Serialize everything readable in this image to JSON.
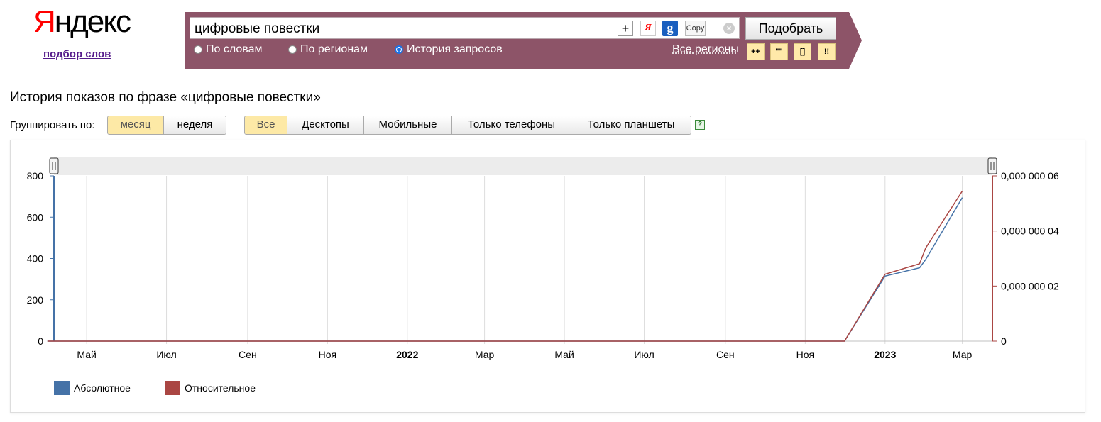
{
  "logo": {
    "first_letter": "Я",
    "rest": "ндекс"
  },
  "wordstat_link": "подбор слов",
  "search": {
    "query": "цифровые повестки",
    "plus_label": "+",
    "ya_label": "Я",
    "google_label": "g",
    "copy_label": "Copy",
    "clear_label": "×",
    "submit_label": "Подобрать"
  },
  "modes": [
    {
      "label": "По словам",
      "checked": false
    },
    {
      "label": "По регионам",
      "checked": false
    },
    {
      "label": "История запросов",
      "checked": true
    }
  ],
  "regions_link": "Все регионы",
  "operators": [
    "++",
    "\"\"",
    "[]",
    "!!"
  ],
  "page_title": "История показов по фразе «цифровые повестки»",
  "group_label": "Группировать по:",
  "group_options": [
    {
      "label": "месяц",
      "active": true
    },
    {
      "label": "неделя",
      "active": false
    }
  ],
  "device_filters": [
    {
      "label": "Все",
      "active": true
    },
    {
      "label": "Десктопы",
      "active": false
    },
    {
      "label": "Мобильные",
      "active": false
    },
    {
      "label": "Только телефоны",
      "active": false
    },
    {
      "label": "Только планшеты",
      "active": false
    }
  ],
  "help_label": "?",
  "colors": {
    "band": "#8d5468",
    "absolute": "#4572a7",
    "relative": "#aa4643",
    "active_tab": "#fde9a6"
  },
  "chart_data": {
    "type": "line",
    "x": [
      "2021-04-01",
      "2021-05-01",
      "2021-06-01",
      "2021-07-01",
      "2021-08-01",
      "2021-09-01",
      "2021-10-01",
      "2021-11-01",
      "2021-12-01",
      "2022-01-01",
      "2022-02-01",
      "2022-03-01",
      "2022-04-01",
      "2022-05-01",
      "2022-06-01",
      "2022-07-01",
      "2022-08-01",
      "2022-09-01",
      "2022-10-01",
      "2022-11-01",
      "2022-12-01",
      "2023-01-01",
      "2023-02-01",
      "2023-03-01"
    ],
    "x_tick_labels": [
      {
        "date": "2021-05-01",
        "label": "Май",
        "bold": false
      },
      {
        "date": "2021-07-01",
        "label": "Июл",
        "bold": false
      },
      {
        "date": "2021-09-01",
        "label": "Сен",
        "bold": false
      },
      {
        "date": "2021-11-01",
        "label": "Ноя",
        "bold": false
      },
      {
        "date": "2022-01-01",
        "label": "2022",
        "bold": true
      },
      {
        "date": "2022-03-01",
        "label": "Мар",
        "bold": false
      },
      {
        "date": "2022-05-01",
        "label": "Май",
        "bold": false
      },
      {
        "date": "2022-07-01",
        "label": "Июл",
        "bold": false
      },
      {
        "date": "2022-09-01",
        "label": "Сен",
        "bold": false
      },
      {
        "date": "2022-11-01",
        "label": "Ноя",
        "bold": false
      },
      {
        "date": "2023-01-01",
        "label": "2023",
        "bold": true
      },
      {
        "date": "2023-03-01",
        "label": "Мар",
        "bold": false
      }
    ],
    "series": [
      {
        "name": "Абсолютное",
        "axis": "left",
        "values": [
          0,
          0,
          0,
          0,
          0,
          0,
          0,
          0,
          0,
          0,
          0,
          0,
          0,
          0,
          0,
          0,
          0,
          0,
          0,
          0,
          0,
          315,
          395,
          695
        ]
      },
      {
        "name": "Относительное",
        "axis": "right",
        "values": [
          0,
          0,
          0,
          0,
          0,
          0,
          0,
          0,
          0,
          0,
          0,
          0,
          0,
          0,
          0,
          0,
          0,
          0,
          0,
          0,
          0,
          2.43e-08,
          3.38e-08,
          5.45e-08
        ]
      }
    ],
    "series_note_points": {
      "Абсолютное_2023-01": 355,
      "Относительное_2023-01": 2.81e-08
    },
    "y_left": {
      "ylim": [
        0,
        800
      ],
      "ticks": [
        "0",
        "200",
        "400",
        "600",
        "800"
      ],
      "tick_values": [
        0,
        200,
        400,
        600,
        800
      ]
    },
    "y_right": {
      "ylim": [
        0,
        6e-08
      ],
      "ticks": [
        "0",
        "0,000 000 02",
        "0,000 000 04",
        "0,000 000 06"
      ],
      "tick_values": [
        0,
        2e-08,
        4e-08,
        6e-08
      ]
    },
    "grid": true,
    "legend_placement": "bottom-left"
  }
}
